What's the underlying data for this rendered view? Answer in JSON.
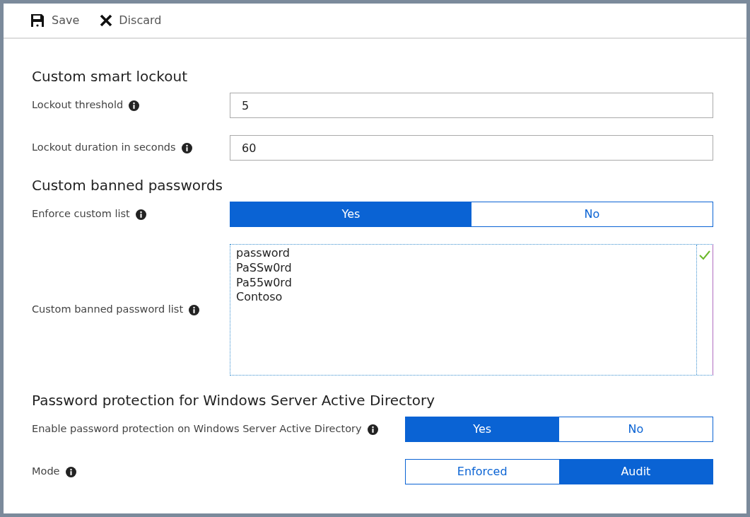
{
  "toolbar": [
    {
      "kind": "save",
      "label": "Save"
    },
    {
      "kind": "discard",
      "label": "Discard"
    }
  ],
  "sections": [
    {
      "title": "Custom smart lockout",
      "rows": [
        {
          "kind": "input",
          "label": "Lockout threshold",
          "info": true,
          "value": "5"
        },
        {
          "kind": "input",
          "label": "Lockout duration in seconds",
          "info": true,
          "value": "60"
        }
      ]
    },
    {
      "title": "Custom banned passwords",
      "rows": [
        {
          "kind": "toggle",
          "label": "Enforce custom list",
          "info": true,
          "options": [
            {
              "label": "Yes",
              "selected": true
            },
            {
              "label": "No",
              "selected": false
            }
          ]
        },
        {
          "kind": "textarea",
          "label": "Custom banned password list",
          "info": true,
          "lines": [
            "password",
            "PaSSw0rd",
            "Pa55w0rd",
            "Contoso"
          ],
          "valid": true
        }
      ]
    },
    {
      "title": "Password protection for Windows Server Active Directory",
      "rows": [
        {
          "kind": "toggle",
          "label": "Enable password protection on Windows Server Active Directory",
          "info": true,
          "options": [
            {
              "label": "Yes",
              "selected": true
            },
            {
              "label": "No",
              "selected": false
            }
          ]
        },
        {
          "kind": "toggle",
          "label": "Mode",
          "info": true,
          "options": [
            {
              "label": "Enforced",
              "selected": false
            },
            {
              "label": "Audit",
              "selected": true
            }
          ]
        }
      ]
    }
  ]
}
